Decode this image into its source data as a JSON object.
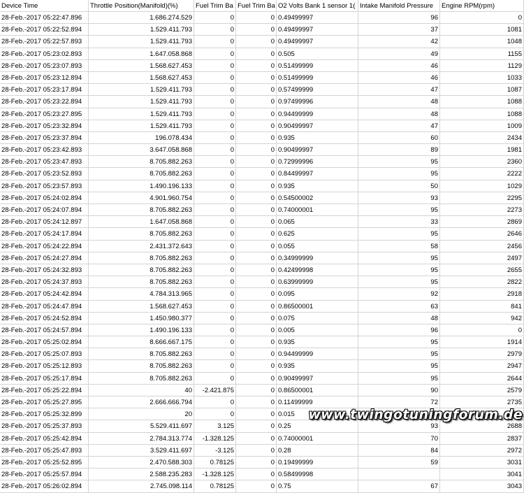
{
  "sheet": {
    "headers": [
      "Device Time",
      "Throttle Position(Manifold)(%)",
      "Fuel Trim Ba",
      "Fuel Trim Ba",
      "O2 Volts Bank 1 sensor 1(",
      "Intake Manifold Pressure",
      "Engine RPM(rpm)"
    ],
    "rows": [
      [
        "28-Feb.-2017 05:22:47.896",
        "1.686.274.529",
        "0",
        "0",
        "0.49499997",
        "96",
        "0"
      ],
      [
        "28-Feb.-2017 05:22:52.894",
        "1.529.411.793",
        "0",
        "0",
        "0.49499997",
        "37",
        "1081"
      ],
      [
        "28-Feb.-2017 05:22:57.893",
        "1.529.411.793",
        "0",
        "0",
        "0.49499997",
        "42",
        "1048"
      ],
      [
        "28-Feb.-2017 05:23:02.893",
        "1.647.058.868",
        "0",
        "0",
        "0.505",
        "49",
        "1155"
      ],
      [
        "28-Feb.-2017 05:23:07.893",
        "1.568.627.453",
        "0",
        "0",
        "0.51499999",
        "46",
        "1129"
      ],
      [
        "28-Feb.-2017 05:23:12.894",
        "1.568.627.453",
        "0",
        "0",
        "0.51499999",
        "46",
        "1033"
      ],
      [
        "28-Feb.-2017 05:23:17.894",
        "1.529.411.793",
        "0",
        "0",
        "0.57499999",
        "47",
        "1087"
      ],
      [
        "28-Feb.-2017 05:23:22.894",
        "1.529.411.793",
        "0",
        "0",
        "0.97499996",
        "48",
        "1088"
      ],
      [
        "28-Feb.-2017 05:23:27.895",
        "1.529.411.793",
        "0",
        "0",
        "0.94499999",
        "48",
        "1088"
      ],
      [
        "28-Feb.-2017 05:23:32.894",
        "1.529.411.793",
        "0",
        "0",
        "0.90499997",
        "47",
        "1009"
      ],
      [
        "28-Feb.-2017 05:23:37.894",
        "196.078.434",
        "0",
        "0",
        "0.935",
        "60",
        "2434"
      ],
      [
        "28-Feb.-2017 05:23:42.893",
        "3.647.058.868",
        "0",
        "0",
        "0.90499997",
        "89",
        "1981"
      ],
      [
        "28-Feb.-2017 05:23:47.893",
        "8.705.882.263",
        "0",
        "0",
        "0.72999996",
        "95",
        "2360"
      ],
      [
        "28-Feb.-2017 05:23:52.893",
        "8.705.882.263",
        "0",
        "0",
        "0.84499997",
        "95",
        "2222"
      ],
      [
        "28-Feb.-2017 05:23:57.893",
        "1.490.196.133",
        "0",
        "0",
        "0.935",
        "50",
        "1029"
      ],
      [
        "28-Feb.-2017 05:24:02.894",
        "4.901.960.754",
        "0",
        "0",
        "0.54500002",
        "93",
        "2295"
      ],
      [
        "28-Feb.-2017 05:24:07.894",
        "8.705.882.263",
        "0",
        "0",
        "0.74000001",
        "95",
        "2273"
      ],
      [
        "28-Feb.-2017 05:24:12.897",
        "1.647.058.868",
        "0",
        "0",
        "0.065",
        "33",
        "2869"
      ],
      [
        "28-Feb.-2017 05:24:17.894",
        "8.705.882.263",
        "0",
        "0",
        "0.625",
        "95",
        "2646"
      ],
      [
        "28-Feb.-2017 05:24:22.894",
        "2.431.372.643",
        "0",
        "0",
        "0.055",
        "58",
        "2456"
      ],
      [
        "28-Feb.-2017 05:24:27.894",
        "8.705.882.263",
        "0",
        "0",
        "0.34999999",
        "95",
        "2497"
      ],
      [
        "28-Feb.-2017 05:24:32.893",
        "8.705.882.263",
        "0",
        "0",
        "0.42499998",
        "95",
        "2655"
      ],
      [
        "28-Feb.-2017 05:24:37.893",
        "8.705.882.263",
        "0",
        "0",
        "0.63999999",
        "95",
        "2822"
      ],
      [
        "28-Feb.-2017 05:24:42.894",
        "4.784.313.965",
        "0",
        "0",
        "0.095",
        "92",
        "2918"
      ],
      [
        "28-Feb.-2017 05:24:47.894",
        "1.568.627.453",
        "0",
        "0",
        "0.86500001",
        "63",
        "841"
      ],
      [
        "28-Feb.-2017 05:24:52.894",
        "1.450.980.377",
        "0",
        "0",
        "0.075",
        "48",
        "942"
      ],
      [
        "28-Feb.-2017 05:24:57.894",
        "1.490.196.133",
        "0",
        "0",
        "0.005",
        "96",
        "0"
      ],
      [
        "28-Feb.-2017 05:25:02.894",
        "8.666.667.175",
        "0",
        "0",
        "0.935",
        "95",
        "1914"
      ],
      [
        "28-Feb.-2017 05:25:07.893",
        "8.705.882.263",
        "0",
        "0",
        "0.94499999",
        "95",
        "2979"
      ],
      [
        "28-Feb.-2017 05:25:12.893",
        "8.705.882.263",
        "0",
        "0",
        "0.935",
        "95",
        "2947"
      ],
      [
        "28-Feb.-2017 05:25:17.894",
        "8.705.882.263",
        "0",
        "0",
        "0.90499997",
        "95",
        "2644"
      ],
      [
        "28-Feb.-2017 05:25:22.894",
        "40",
        "-2.421.875",
        "0",
        "0.86500001",
        "90",
        "2579"
      ],
      [
        "28-Feb.-2017 05:25:27.895",
        "2.666.666.794",
        "0",
        "0",
        "0.11499999",
        "72",
        "2735"
      ],
      [
        "28-Feb.-2017 05:25:32.899",
        "20",
        "0",
        "0",
        "0.015",
        "32",
        "2482"
      ],
      [
        "28-Feb.-2017 05:25:37.893",
        "5.529.411.697",
        "3.125",
        "0",
        "0.25",
        "93",
        "2688"
      ],
      [
        "28-Feb.-2017 05:25:42.894",
        "2.784.313.774",
        "-1.328.125",
        "0",
        "0.74000001",
        "70",
        "2837"
      ],
      [
        "28-Feb.-2017 05:25:47.893",
        "3.529.411.697",
        "-3.125",
        "0",
        "0.28",
        "84",
        "2972"
      ],
      [
        "28-Feb.-2017 05:25:52.895",
        "2.470.588.303",
        "0.78125",
        "0",
        "0.19499999",
        "59",
        "3031"
      ],
      [
        "28-Feb.-2017 05:25:57.894",
        "2.588.235.283",
        "-1.328.125",
        "0",
        "0.58499998",
        "",
        "3041"
      ],
      [
        "28-Feb.-2017 05:26:02.894",
        "2.745.098.114",
        "0.78125",
        "0",
        "0.75",
        "67",
        "3043"
      ]
    ]
  },
  "watermark": {
    "text": "www.twingotuningforum.de"
  }
}
